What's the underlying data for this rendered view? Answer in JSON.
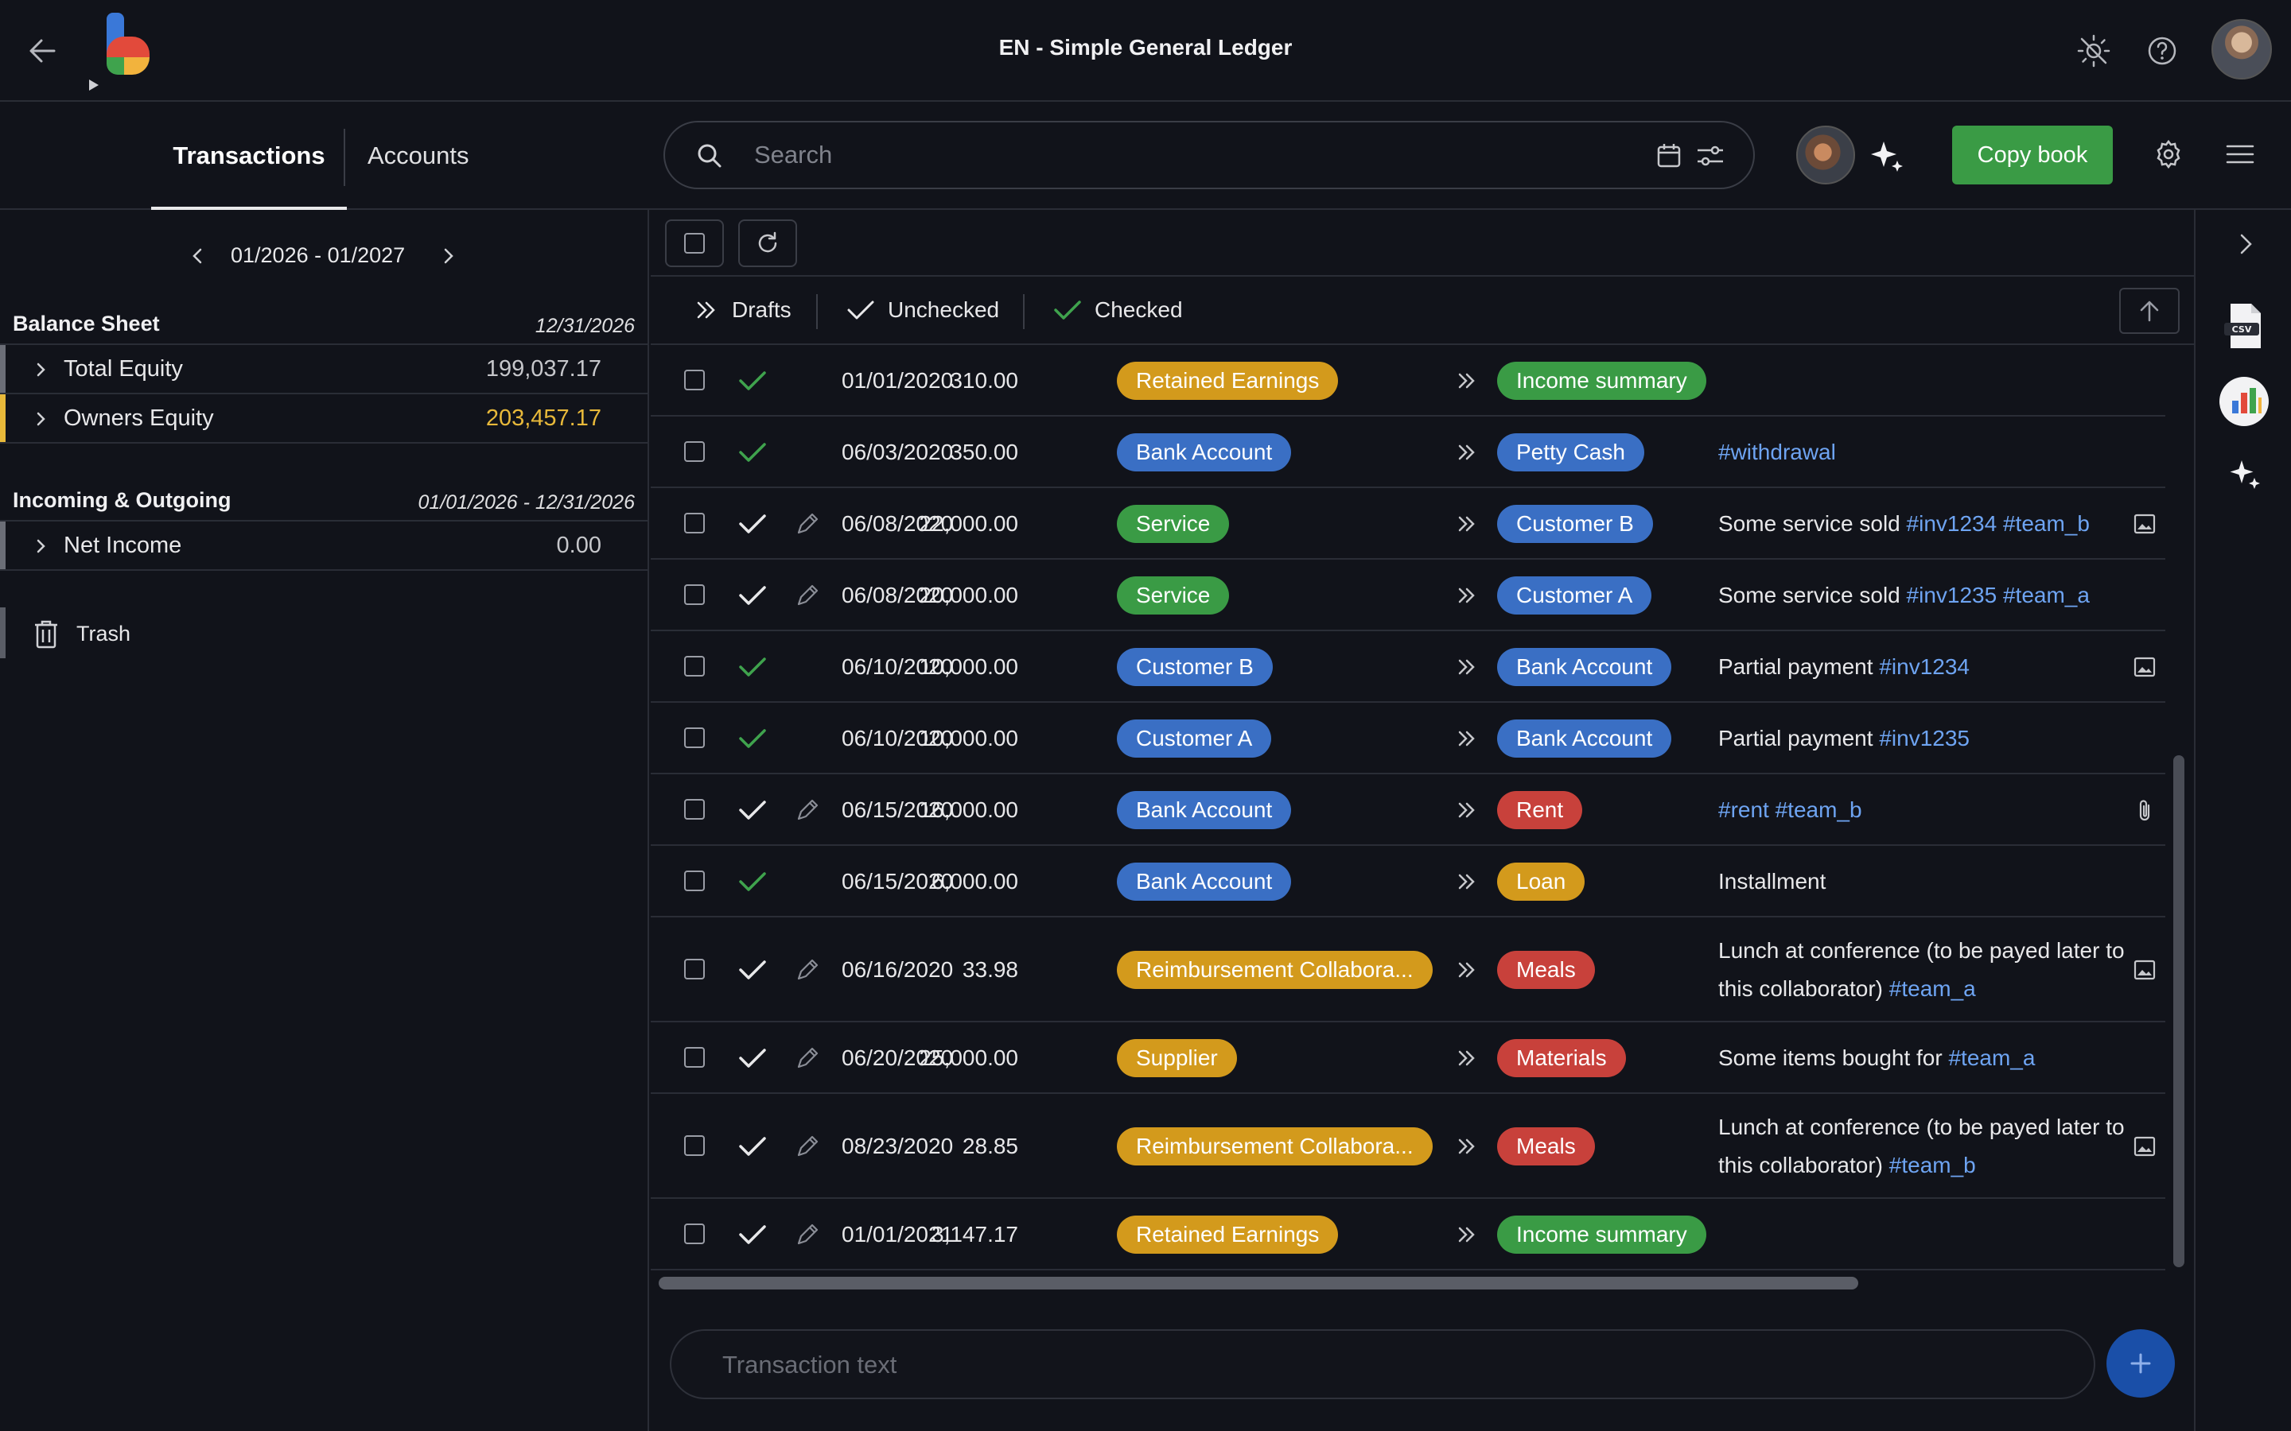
{
  "app": {
    "book_title": "EN - Simple General Ledger",
    "logo_letter": "b"
  },
  "tabs": [
    {
      "label": "Transactions",
      "active": true
    },
    {
      "label": "Accounts",
      "active": false
    }
  ],
  "search": {
    "placeholder": "Search",
    "value": ""
  },
  "toolbar": {
    "copy_book_label": "Copy book"
  },
  "period": {
    "label": "01/2026 - 01/2027"
  },
  "balance_sheet": {
    "title": "Balance Sheet",
    "date": "12/31/2026",
    "rows": [
      {
        "name": "Total Equity",
        "value": "199,037.17",
        "color": "#6b6e77"
      },
      {
        "name": "Owners Equity",
        "value": "203,457.17",
        "color": "#e8b93a"
      }
    ]
  },
  "incoming_outgoing": {
    "title": "Incoming & Outgoing",
    "date": "01/01/2026 - 12/31/2026",
    "rows": [
      {
        "name": "Net Income",
        "value": "0.00",
        "color": "#6b6e77"
      }
    ]
  },
  "trash": {
    "label": "Trash"
  },
  "filters": {
    "drafts": "Drafts",
    "unchecked": "Unchecked",
    "checked": "Checked"
  },
  "colors": {
    "green": "#3a9b45",
    "blue": "#3a6fc4",
    "yellow": "#d39a1c",
    "red": "#c8413b",
    "check_green": "#3fa34d",
    "hashtag": "#6ea4f2"
  },
  "transactions": [
    {
      "status": "checked",
      "editable": false,
      "date": "01/01/2020",
      "amount": "310.00",
      "from": {
        "name": "Retained Earnings",
        "color": "yellow"
      },
      "to": {
        "name": "Income summary",
        "color": "green"
      },
      "description": [],
      "attachment": null
    },
    {
      "status": "checked",
      "editable": false,
      "date": "06/03/2020",
      "amount": "350.00",
      "from": {
        "name": "Bank Account",
        "color": "blue"
      },
      "to": {
        "name": "Petty Cash",
        "color": "blue"
      },
      "description": [
        {
          "t": "#withdrawal",
          "hash": true
        }
      ],
      "attachment": null
    },
    {
      "status": "unchecked",
      "editable": true,
      "date": "06/08/2020",
      "amount": "22,000.00",
      "from": {
        "name": "Service",
        "color": "green"
      },
      "to": {
        "name": "Customer B",
        "color": "blue"
      },
      "description": [
        {
          "t": "Some service sold "
        },
        {
          "t": "#inv1234",
          "hash": true
        },
        {
          "t": " "
        },
        {
          "t": "#team_b",
          "hash": true
        }
      ],
      "attachment": "image"
    },
    {
      "status": "unchecked",
      "editable": true,
      "date": "06/08/2020",
      "amount": "20,000.00",
      "from": {
        "name": "Service",
        "color": "green"
      },
      "to": {
        "name": "Customer A",
        "color": "blue"
      },
      "description": [
        {
          "t": "Some service sold "
        },
        {
          "t": "#inv1235",
          "hash": true
        },
        {
          "t": " "
        },
        {
          "t": "#team_a",
          "hash": true
        }
      ],
      "attachment": null
    },
    {
      "status": "checked",
      "editable": false,
      "date": "06/10/2020",
      "amount": "10,000.00",
      "from": {
        "name": "Customer B",
        "color": "blue"
      },
      "to": {
        "name": "Bank Account",
        "color": "blue"
      },
      "description": [
        {
          "t": "Partial payment "
        },
        {
          "t": "#inv1234",
          "hash": true
        }
      ],
      "attachment": "image"
    },
    {
      "status": "checked",
      "editable": false,
      "date": "06/10/2020",
      "amount": "10,000.00",
      "from": {
        "name": "Customer A",
        "color": "blue"
      },
      "to": {
        "name": "Bank Account",
        "color": "blue"
      },
      "description": [
        {
          "t": "Partial payment "
        },
        {
          "t": "#inv1235",
          "hash": true
        }
      ],
      "attachment": null
    },
    {
      "status": "unchecked",
      "editable": true,
      "date": "06/15/2020",
      "amount": "16,000.00",
      "from": {
        "name": "Bank Account",
        "color": "blue"
      },
      "to": {
        "name": "Rent",
        "color": "red"
      },
      "description": [
        {
          "t": "#rent",
          "hash": true
        },
        {
          "t": " "
        },
        {
          "t": "#team_b",
          "hash": true
        }
      ],
      "attachment": "clip"
    },
    {
      "status": "checked",
      "editable": false,
      "date": "06/15/2020",
      "amount": "6,000.00",
      "from": {
        "name": "Bank Account",
        "color": "blue"
      },
      "to": {
        "name": "Loan",
        "color": "yellow"
      },
      "description": [
        {
          "t": "Installment"
        }
      ],
      "attachment": null
    },
    {
      "status": "unchecked",
      "editable": true,
      "date": "06/16/2020",
      "amount": "33.98",
      "from": {
        "name": "Reimbursement Collabora...",
        "color": "yellow"
      },
      "to": {
        "name": "Meals",
        "color": "red"
      },
      "description": [
        {
          "t": "Lunch at conference (to be payed later to this collaborator) "
        },
        {
          "t": "#team_a",
          "hash": true
        }
      ],
      "attachment": "image"
    },
    {
      "status": "unchecked",
      "editable": true,
      "date": "06/20/2020",
      "amount": "25,000.00",
      "from": {
        "name": "Supplier",
        "color": "yellow"
      },
      "to": {
        "name": "Materials",
        "color": "red"
      },
      "description": [
        {
          "t": "Some items bought for "
        },
        {
          "t": "#team_a",
          "hash": true
        }
      ],
      "attachment": null
    },
    {
      "status": "unchecked",
      "editable": true,
      "date": "08/23/2020",
      "amount": "28.85",
      "from": {
        "name": "Reimbursement Collabora...",
        "color": "yellow"
      },
      "to": {
        "name": "Meals",
        "color": "red"
      },
      "description": [
        {
          "t": "Lunch at conference (to be payed later to this collaborator) "
        },
        {
          "t": "#team_b",
          "hash": true
        }
      ],
      "attachment": "image"
    },
    {
      "status": "unchecked",
      "editable": true,
      "date": "01/01/2021",
      "amount": "3,147.17",
      "from": {
        "name": "Retained Earnings",
        "color": "yellow"
      },
      "to": {
        "name": "Income summary",
        "color": "green"
      },
      "description": [],
      "attachment": null
    }
  ],
  "composer": {
    "placeholder": "Transaction text"
  },
  "icons": {
    "back": "arrow-left-icon",
    "theme": "sun-icon",
    "help": "question-icon",
    "search": "search-icon",
    "calendar": "calendar-icon",
    "filter": "sliders-icon",
    "spark": "sparkle-icon",
    "settings": "gear-icon",
    "menu": "hamburger-icon",
    "trash": "trash-icon",
    "csv": "csv-file-icon",
    "chart": "bar-chart-icon"
  }
}
